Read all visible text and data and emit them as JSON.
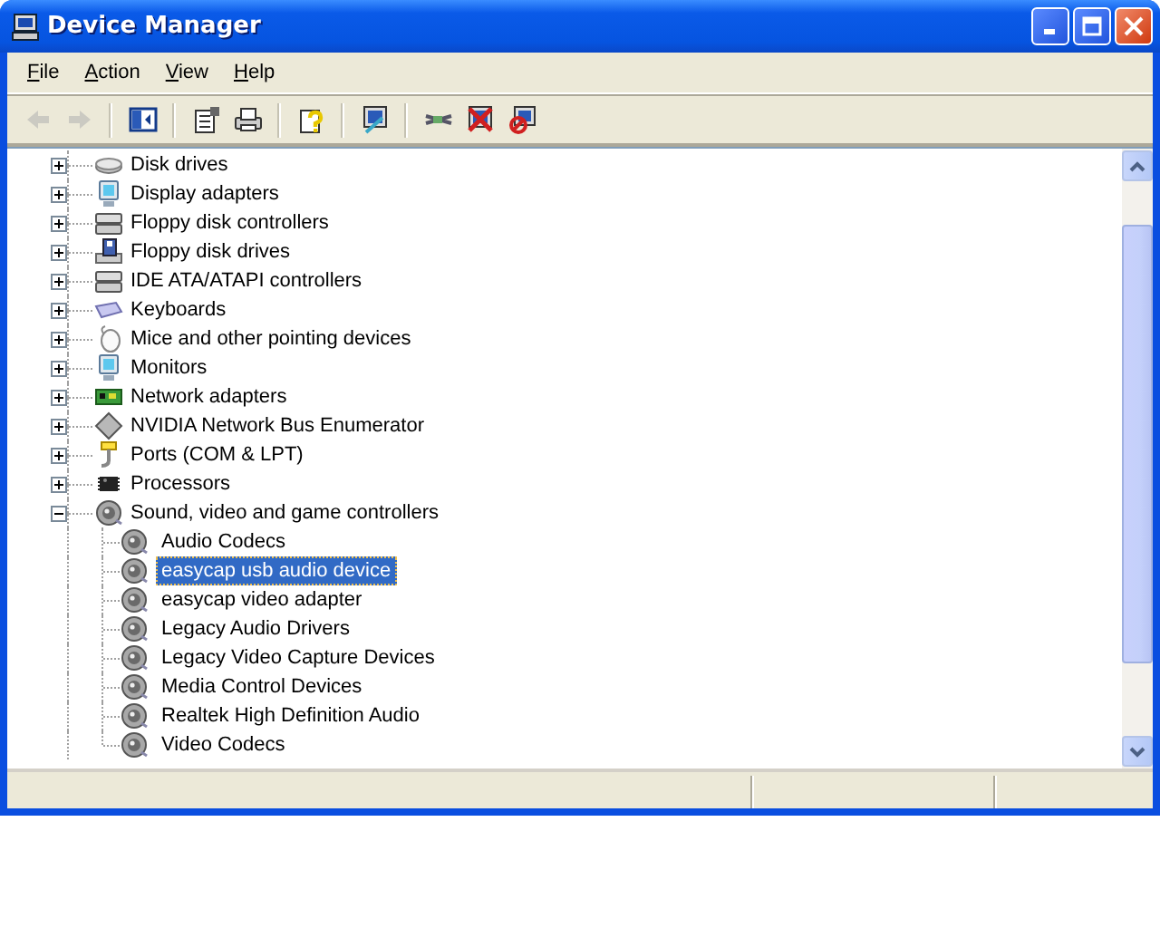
{
  "window": {
    "title": "Device Manager"
  },
  "menu": [
    {
      "label": "File"
    },
    {
      "label": "Action"
    },
    {
      "label": "View"
    },
    {
      "label": "Help"
    }
  ],
  "toolbar": [
    [
      {
        "kind": "back",
        "disabled": true
      },
      {
        "kind": "forward",
        "disabled": true
      }
    ],
    [
      {
        "kind": "console-tree",
        "disabled": false
      }
    ],
    [
      {
        "kind": "properties",
        "disabled": false
      },
      {
        "kind": "print",
        "disabled": false
      }
    ],
    [
      {
        "kind": "help",
        "disabled": false
      }
    ],
    [
      {
        "kind": "scan",
        "disabled": false
      }
    ],
    [
      {
        "kind": "update",
        "disabled": false
      },
      {
        "kind": "uninstall",
        "disabled": false
      },
      {
        "kind": "disable",
        "disabled": false
      }
    ]
  ],
  "tree": {
    "items": [
      {
        "label": "Disk drives",
        "kind": "disk",
        "expanded": false
      },
      {
        "label": "Display adapters",
        "kind": "display",
        "expanded": false
      },
      {
        "label": "Floppy disk controllers",
        "kind": "controller",
        "expanded": false
      },
      {
        "label": "Floppy disk drives",
        "kind": "floppy",
        "expanded": false
      },
      {
        "label": "IDE ATA/ATAPI controllers",
        "kind": "controller",
        "expanded": false
      },
      {
        "label": "Keyboards",
        "kind": "keyboard",
        "expanded": false
      },
      {
        "label": "Mice and other pointing devices",
        "kind": "mouse",
        "expanded": false
      },
      {
        "label": "Monitors",
        "kind": "display",
        "expanded": false
      },
      {
        "label": "Network adapters",
        "kind": "network",
        "expanded": false
      },
      {
        "label": "NVIDIA Network Bus Enumerator",
        "kind": "bus",
        "expanded": false
      },
      {
        "label": "Ports (COM & LPT)",
        "kind": "port",
        "expanded": false
      },
      {
        "label": "Processors",
        "kind": "processor",
        "expanded": false
      },
      {
        "label": "Sound, video and game controllers",
        "kind": "sound",
        "expanded": true,
        "children": [
          {
            "label": "Audio Codecs",
            "kind": "sound",
            "selected": false
          },
          {
            "label": "easycap usb audio device",
            "kind": "sound",
            "selected": true
          },
          {
            "label": "easycap video adapter",
            "kind": "sound",
            "selected": false
          },
          {
            "label": "Legacy Audio Drivers",
            "kind": "sound",
            "selected": false
          },
          {
            "label": "Legacy Video Capture Devices",
            "kind": "sound",
            "selected": false
          },
          {
            "label": "Media Control Devices",
            "kind": "sound",
            "selected": false
          },
          {
            "label": "Realtek High Definition Audio",
            "kind": "sound",
            "selected": false
          },
          {
            "label": "Video Codecs",
            "kind": "sound",
            "selected": false
          }
        ]
      }
    ]
  }
}
